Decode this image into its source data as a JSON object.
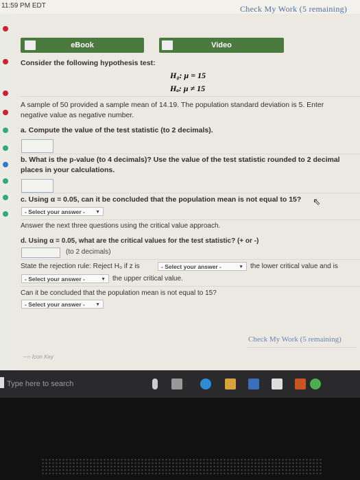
{
  "status": {
    "time": "11:59 PM EDT"
  },
  "header": {
    "check_work": "Check My Work (5 remaining)"
  },
  "tabs": [
    {
      "label": "eBook"
    },
    {
      "label": "Video"
    }
  ],
  "question": {
    "intro": "Consider the following hypothesis test:",
    "h0": "H₀: μ = 15",
    "ha": "Hₐ: μ ≠ 15",
    "sample_text": "A sample of 50 provided a sample mean of 14.19. The population standard deviation is 5. Enter negative value as negative number.",
    "a": "a. Compute the value of the test statistic (to 2 decimals).",
    "b": "b. What is the p-value (to 4 decimals)? Use the value of the test statistic rounded to 2 decimal places in your calculations.",
    "c": "c. Using α = 0.05, can it be concluded that the population mean is not equal to 15?",
    "select_placeholder": "- Select your answer -",
    "critical_intro": "Answer the next three questions using the critical value approach.",
    "d": "d. Using α = 0.05, what are the critical values for the test statistic? (+ or -)",
    "d_hint": "(to 2 decimals)",
    "reject_prefix": "State the rejection rule: Reject H₀ if z is",
    "reject_mid": "the lower critical value and is",
    "reject_end": "the upper critical value.",
    "conclude": "Can it be concluded that the population mean is not equal to 15?"
  },
  "footer": {
    "check_work": "Check My Work (5 remaining)",
    "icon_key": "Icon Key"
  },
  "taskbar": {
    "search_placeholder": "Type here to search"
  }
}
